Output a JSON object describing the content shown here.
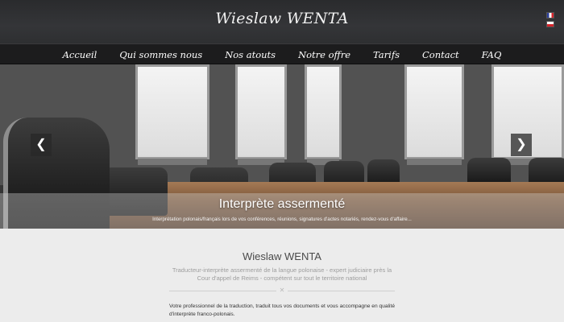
{
  "header": {
    "site_title": "Wieslaw WENTA",
    "languages": [
      {
        "code": "fr",
        "icon": "flag-france-icon"
      },
      {
        "code": "pl",
        "icon": "flag-poland-icon"
      }
    ]
  },
  "nav": {
    "items": [
      {
        "label": "Accueil"
      },
      {
        "label": "Qui sommes nous"
      },
      {
        "label": "Nos atouts"
      },
      {
        "label": "Notre offre"
      },
      {
        "label": "Tarifs"
      },
      {
        "label": "Contact"
      },
      {
        "label": "FAQ"
      }
    ]
  },
  "slider": {
    "prev_icon": "chevron-left-icon",
    "next_icon": "chevron-right-icon",
    "prev_glyph": "❮",
    "next_glyph": "❯",
    "caption_title": "Interprète assermenté",
    "caption_text": "Interprétation polonais/français lors de vos conférences, réunions, signatures d'actes notariés, rendez-vous d'affaire..."
  },
  "content": {
    "title": "Wieslaw WENTA",
    "subtitle": "Traducteur-interprète assermenté de la langue polonaise - expert judiciaire près la Cour d'appel de Reims - compétent sur tout le territoire national",
    "divider_glyph": "✕",
    "intro": "Votre professionnel de la traduction, traduit tous vos documents et vous accompagne en qualité d'interprète franco-polonais."
  },
  "colors": {
    "header_bg": "#2e2f31",
    "nav_bg": "#1c1c1d",
    "page_bg": "#ececec",
    "accent_text": "#4a4a4a"
  }
}
